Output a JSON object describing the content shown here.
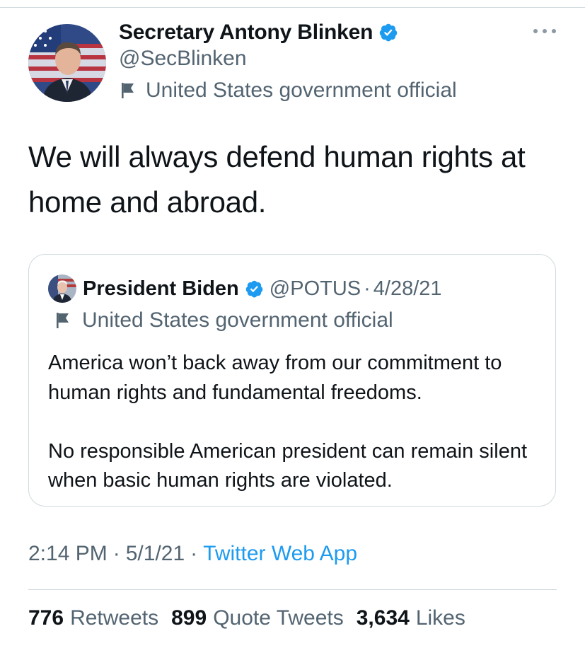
{
  "tweet": {
    "author": {
      "name": "Secretary Antony Blinken",
      "handle": "@SecBlinken",
      "label": "United States government official"
    },
    "text": "We will always defend human rights at home and abroad.",
    "quoted": {
      "name": "President Biden",
      "handle": "@POTUS",
      "separator": "·",
      "date": "4/28/21",
      "label": "United States government official",
      "paragraphs": [
        "America won’t back away from our commitment to human rights and fundamental freedoms.",
        "No responsible American president can remain silent when basic human rights are violated."
      ]
    },
    "meta": {
      "time": "2:14 PM",
      "separator": "·",
      "date": "5/1/21",
      "source": "Twitter Web App"
    },
    "stats": {
      "retweets": {
        "count": "776",
        "label": "Retweets"
      },
      "quote_tweets": {
        "count": "899",
        "label": "Quote Tweets"
      },
      "likes": {
        "count": "3,634",
        "label": "Likes"
      }
    }
  },
  "colors": {
    "accent": "#1d9bf0",
    "text_primary": "#0f1419",
    "text_secondary": "#536471",
    "border": "#cfd9de"
  },
  "icons": {
    "verified": "verified-badge-icon",
    "flag": "flag-icon",
    "more": "more-options-icon"
  }
}
